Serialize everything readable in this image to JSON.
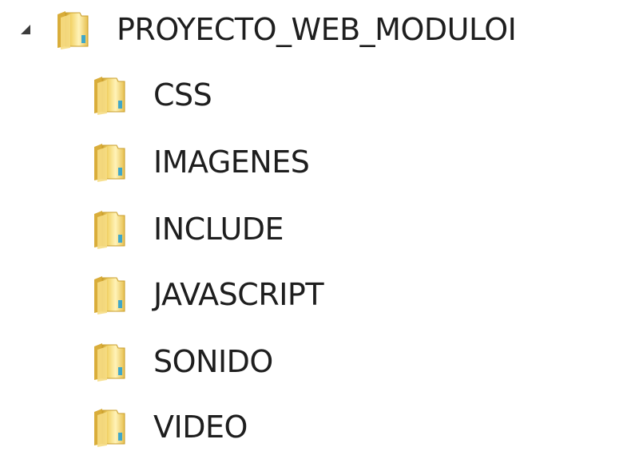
{
  "tree": {
    "root": {
      "label": "PROYECTO_WEB_MODULOI",
      "expanded": true,
      "icon": "folder-icon",
      "expander_icon": "expanded-triangle-icon"
    },
    "children": [
      {
        "label": "CSS",
        "icon": "folder-icon"
      },
      {
        "label": "IMAGENES",
        "icon": "folder-icon"
      },
      {
        "label": "INCLUDE",
        "icon": "folder-icon"
      },
      {
        "label": "JAVASCRIPT",
        "icon": "folder-icon"
      },
      {
        "label": "SONIDO",
        "icon": "folder-icon"
      },
      {
        "label": "VIDEO",
        "icon": "folder-icon"
      }
    ]
  },
  "colors": {
    "folder_light": "#fff3b8",
    "folder_mid": "#f3d46a",
    "folder_dark": "#c99d2a",
    "folder_accent": "#3fa7c9",
    "text": "#1e1e1e",
    "expander": "#3c3c3c"
  }
}
